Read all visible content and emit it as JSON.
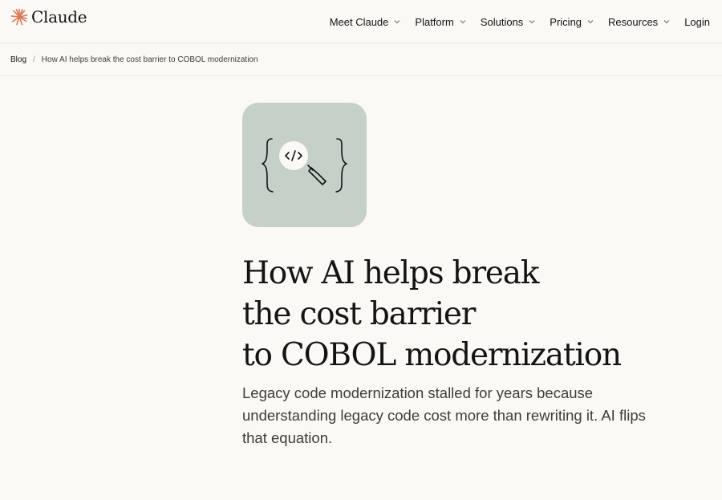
{
  "nav": {
    "brand": "Claude",
    "items": [
      {
        "label": "Meet Claude",
        "has_dropdown": true
      },
      {
        "label": "Platform",
        "has_dropdown": true
      },
      {
        "label": "Solutions",
        "has_dropdown": true
      },
      {
        "label": "Pricing",
        "has_dropdown": true
      },
      {
        "label": "Resources",
        "has_dropdown": true
      },
      {
        "label": "Login",
        "has_dropdown": false
      }
    ]
  },
  "breadcrumb": {
    "parent": "Blog",
    "separator": "/",
    "current": "How AI helps break the cost barrier to COBOL modernization"
  },
  "article": {
    "title_lines": [
      "How AI helps break",
      "the cost barrier",
      "to COBOL modernization"
    ],
    "subtitle": "Legacy code modernization stalled for years because understanding legacy code cost more than rewriting it. AI flips that equation.",
    "hero_icon": "code-magnifier-icon"
  },
  "colors": {
    "background": "#faf9f5",
    "text": "#141413",
    "brand_mark": "#d97757",
    "hero_tile": "#c5d1c8",
    "divider": "#e8e6dc"
  }
}
